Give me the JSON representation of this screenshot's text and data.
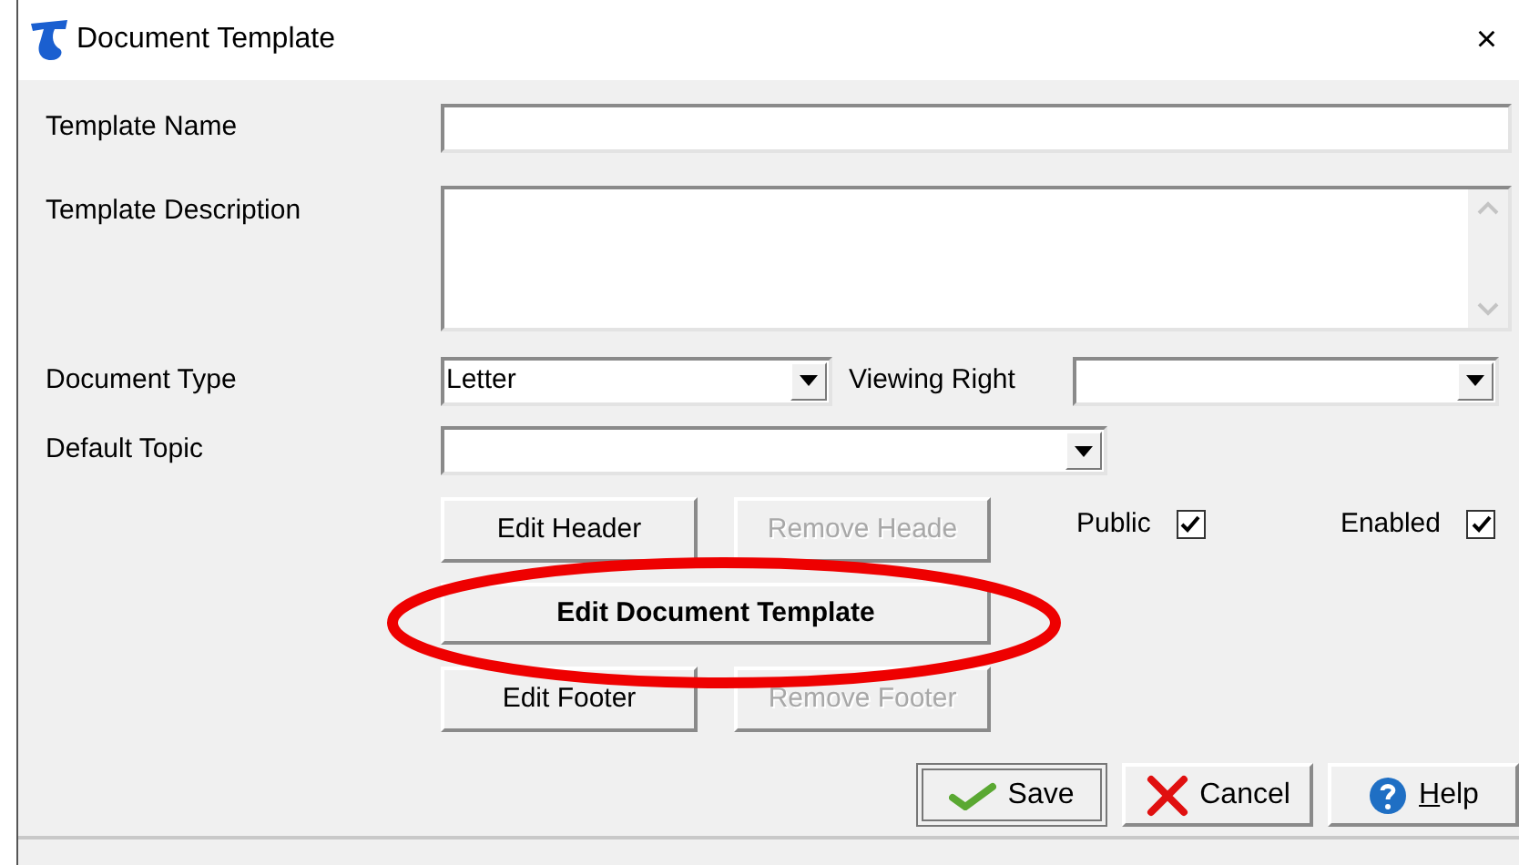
{
  "window": {
    "title": "Document Template",
    "close": "×"
  },
  "template_name": {
    "label": "Template Name"
  },
  "template_description": {
    "label": "Template Description"
  },
  "document_type": {
    "label": "Document Type",
    "value": "Letter"
  },
  "viewing_right": {
    "label": "Viewing Right"
  },
  "default_topic": {
    "label": "Default Topic"
  },
  "checkboxes": [
    {
      "label": "Public",
      "checked": true
    },
    {
      "label": "Enabled",
      "checked": true
    }
  ],
  "template_buttons": [
    {
      "label": "Edit Header",
      "disabled": false,
      "highlighted": false
    },
    {
      "label": "Remove Heade",
      "disabled": true,
      "highlighted": false
    },
    {
      "label": "Edit Document Template",
      "disabled": false,
      "highlighted": true
    },
    {
      "label": "Edit Footer",
      "disabled": false,
      "highlighted": false
    },
    {
      "label": "Remove Footer",
      "disabled": true,
      "highlighted": false
    }
  ],
  "dialog_buttons": [
    {
      "label": "Save",
      "kind": "save",
      "default": true
    },
    {
      "label": "Cancel",
      "kind": "cancel",
      "default": false
    },
    {
      "label": "Help",
      "kind": "help",
      "default": false
    }
  ]
}
